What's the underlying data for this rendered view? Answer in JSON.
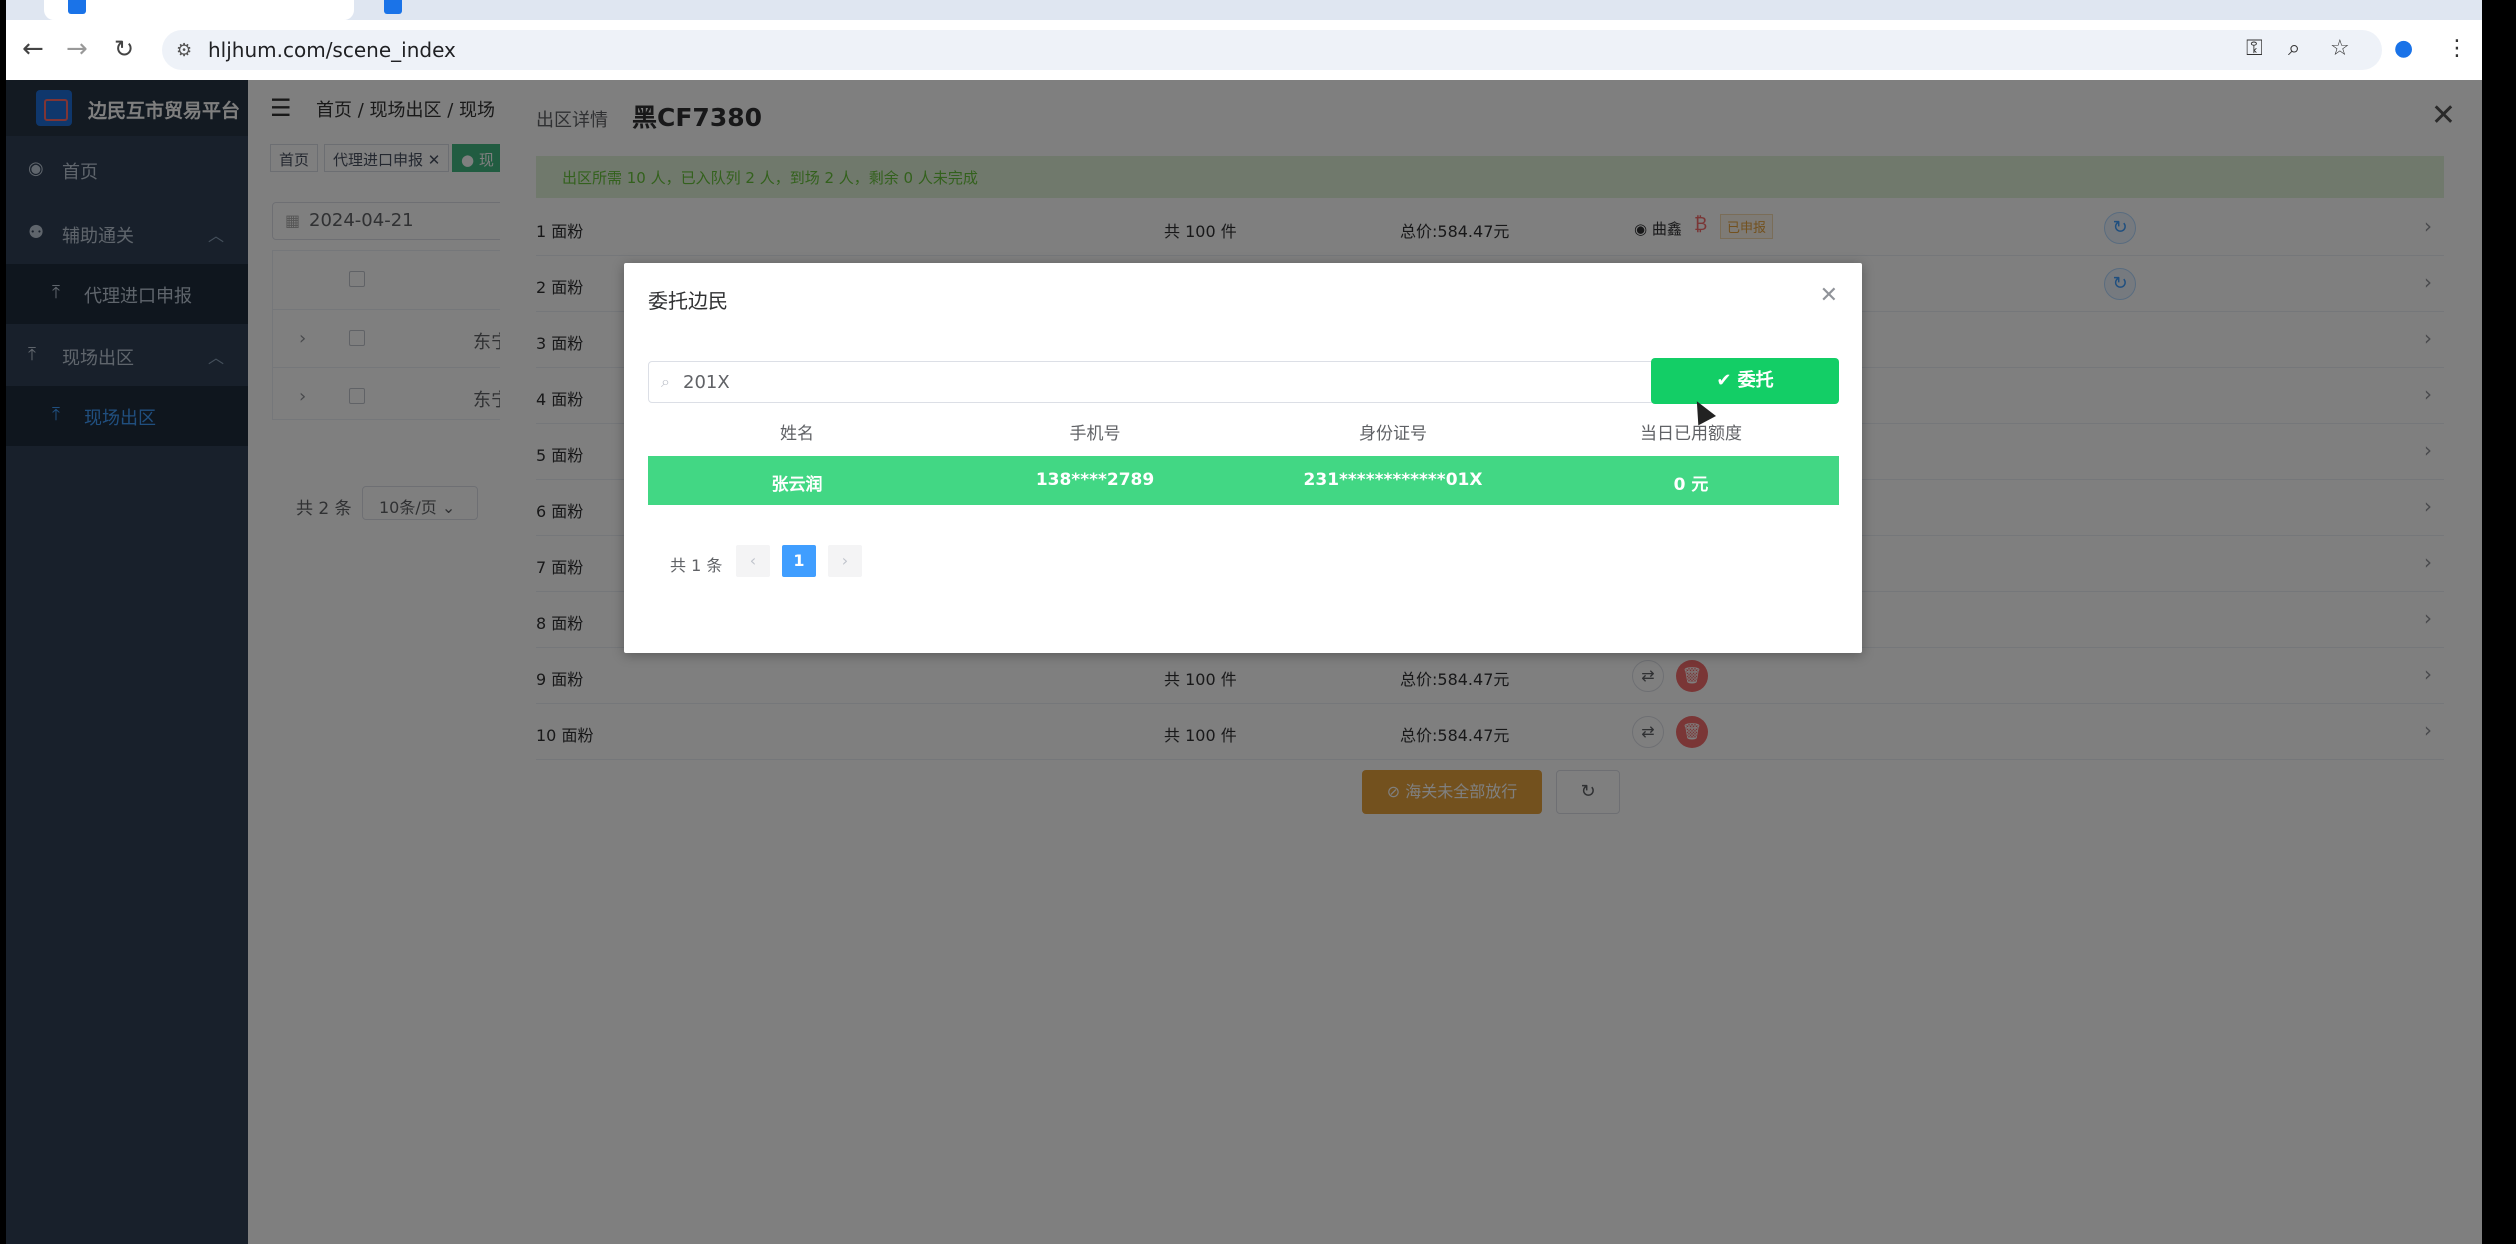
{
  "browser": {
    "url": "hljhum.com/scene_index"
  },
  "sidebar": {
    "title": "边民互市贸易平台",
    "items": [
      {
        "label": "首页",
        "icon": "dashboard-icon"
      },
      {
        "label": "辅助通关",
        "icon": "user-icon"
      },
      {
        "label": "代理进口申报",
        "icon": "upload-icon"
      },
      {
        "label": "现场出区",
        "icon": "upload-icon"
      },
      {
        "label": "现场出区",
        "icon": "upload-icon"
      }
    ]
  },
  "header": {
    "breadcrumb": "首页 / 现场出区 / 现场"
  },
  "tags": [
    "首页",
    "代理进口申报 ✕",
    "● 现"
  ],
  "filter": {
    "date": "2024-04-21"
  },
  "bg_table": {
    "rows": [
      "东宁",
      "东宁"
    ]
  },
  "bg_pager": {
    "total": "共 2 条",
    "page_size": "10条/页"
  },
  "drawer": {
    "title": "出区详情",
    "plate": "黑CF7380",
    "alert": "出区所需 10 人，已入队列 2 人，到场 2 人，剩余 0 人未完成",
    "rows": [
      {
        "name": "1 面粉",
        "qty": "共 100 件",
        "price": "总价:584.47元",
        "who": "曲鑫",
        "badge": "已申报"
      },
      {
        "name": "2 面粉"
      },
      {
        "name": "3 面粉"
      },
      {
        "name": "4 面粉"
      },
      {
        "name": "5 面粉"
      },
      {
        "name": "6 面粉"
      },
      {
        "name": "7 面粉"
      },
      {
        "name": "8 面粉"
      },
      {
        "name": "9 面粉",
        "qty": "共 100 件",
        "price": "总价:584.47元"
      },
      {
        "name": "10 面粉",
        "qty": "共 100 件",
        "price": "总价:584.47元"
      }
    ],
    "release_btn": "⊘ 海关未全部放行"
  },
  "modal": {
    "title": "委托边民",
    "search_value": "201X",
    "entrust_btn": "✔ 委托",
    "columns": [
      "姓名",
      "手机号",
      "身份证号",
      "当日已用额度"
    ],
    "row": {
      "name": "张云润",
      "phone": "138****2789",
      "id": "231************01X",
      "quota": "0 元"
    },
    "pager": {
      "total": "共 1 条",
      "prev": "‹",
      "current": "1",
      "next": "›"
    }
  }
}
